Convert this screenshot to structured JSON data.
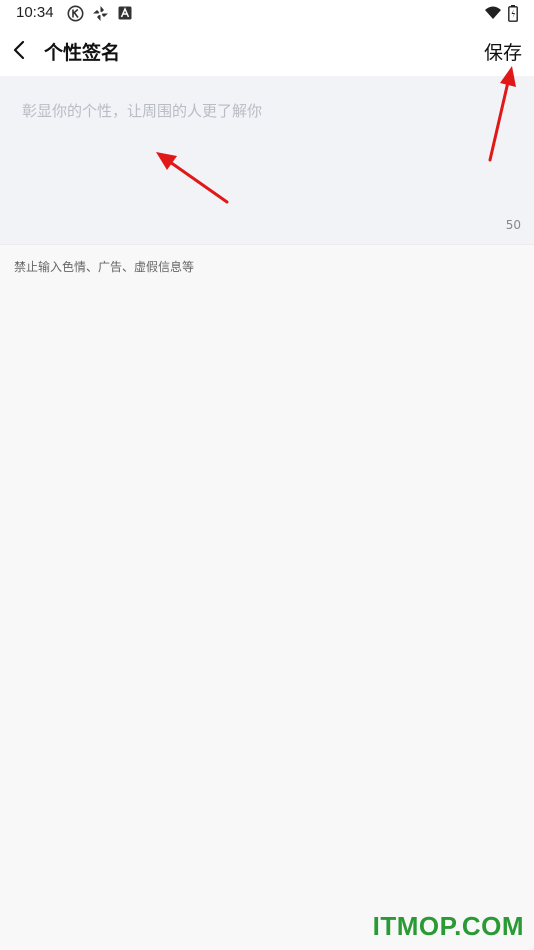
{
  "status_bar": {
    "time": "10:34",
    "icons": [
      "k-circle-icon",
      "pinwheel-icon",
      "a-badge-icon",
      "wifi-icon",
      "battery-icon"
    ]
  },
  "header": {
    "title": "个性签名",
    "save_label": "保存",
    "back_icon": "chevron-left-icon"
  },
  "signature": {
    "placeholder": "彰显你的个性，让周围的人更了解你",
    "value": "",
    "char_limit": "50"
  },
  "notice": "禁止输入色情、广告、虚假信息等",
  "watermark": "ITMOP.COM",
  "colors": {
    "page_bg": "#f8f8f8",
    "input_bg": "#f2f3f7",
    "arrow": "#e01818",
    "watermark": "#2a9a35"
  }
}
